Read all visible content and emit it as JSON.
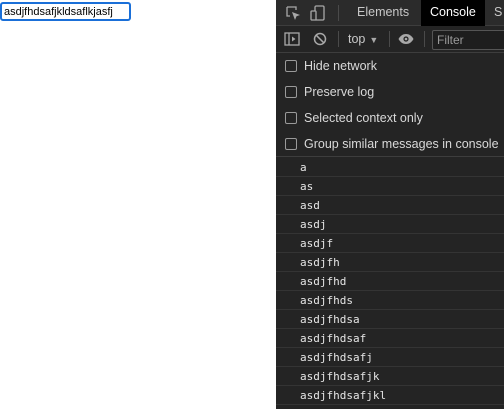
{
  "page": {
    "input_value": "asdjfhdsafjkldsaflkjasfj"
  },
  "devtools": {
    "tabs": [
      {
        "label": "Elements",
        "active": false
      },
      {
        "label": "Console",
        "active": true
      },
      {
        "label": "S",
        "active": false
      }
    ],
    "toolbar": {
      "context_label": "top",
      "filter_placeholder": "Filter"
    },
    "settings": [
      {
        "label": "Hide network",
        "checked": false
      },
      {
        "label": "Preserve log",
        "checked": false
      },
      {
        "label": "Selected context only",
        "checked": false
      },
      {
        "label": "Group similar messages in console",
        "checked": false
      }
    ],
    "log": [
      "a",
      "as",
      "asd",
      "asdj",
      "asdjf",
      "asdjfh",
      "asdjfhd",
      "asdjfhds",
      "asdjfhdsa",
      "asdjfhdsaf",
      "asdjfhdsafj",
      "asdjfhdsafjk",
      "asdjfhdsafjkl"
    ]
  },
  "colors": {
    "devtools_bg": "#242424",
    "active_tab_bg": "#000000",
    "input_focus_border": "#1a6fd8"
  },
  "icons": [
    "inspect-element-icon",
    "device-toolbar-icon",
    "sidebar-toggle-icon",
    "clear-console-icon",
    "eye-icon",
    "caret-down-icon"
  ]
}
